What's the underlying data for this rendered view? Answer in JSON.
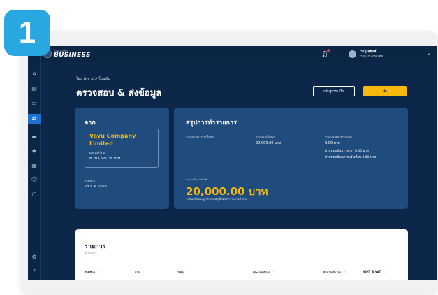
{
  "step_badge": "1",
  "brand": {
    "small": "Krungthai",
    "main": "BUSINESS"
  },
  "user": {
    "name": "วายุ อิชิงค์",
    "company": "วายุ ประเทศไทย"
  },
  "breadcrumb": "โอน & จ่าย > โอนเงิน",
  "page_title": "ตรวจสอบ & ส่งข้อมูล",
  "buttons": {
    "home": "กลับสู่การแก้ไข",
    "send": "ส่ง"
  },
  "from_card": {
    "title": "จาก",
    "account_name": "Vayu Company Limited",
    "balance_label": "ยอดเงินที่ใช้ได้",
    "balance_value": "8,203,321.36 บาท",
    "date_label": "วันที่มีผล",
    "date_value": "23 มี.ค. 2022"
  },
  "summary_card": {
    "title": "สรุปการทำรายการ",
    "count_label": "จำนวนรายการรวมทั้งหมด",
    "count_value": "1",
    "amount_label": "จำนวนเงินทั้งหมด",
    "amount_value": "20,000.00 บาท",
    "fee_label": "รายละเอียดค่าธรรมเนียม",
    "fee_value": "0.00 บาท",
    "fee_item_1": "ค่าธรรมเนียมรายการ 0.00 บาท",
    "fee_item_2": "ค่าธรรมเนียมการแจ้งเตือน 0.00 บาท",
    "total_label": "จำนวนเงินรวมทั้งสิ้น",
    "total_value": "20,000.00 บาท",
    "note": "วงเงินบริษัทจะถูกหักจากบัญชี เมื่อทำรายการสำเร็จ"
  },
  "list_panel": {
    "title": "รายการ",
    "count": "1 รายการ",
    "columns": [
      "วันที่มีผล",
      "จาก",
      "ไปยัง",
      "ประเภทบริการ",
      "จำนวนเงินโอน",
      "WHT & VAT"
    ]
  },
  "sidebar_icons": [
    "home-icon",
    "document-icon",
    "wallet-icon",
    "transfer-icon",
    "card-icon",
    "tag-icon",
    "report-icon",
    "users-icon",
    "history-icon",
    "settings-icon",
    "help-icon"
  ],
  "colors": {
    "navy": "#0c2749",
    "card": "#1f4c7d",
    "accent": "#f7b80f",
    "badge": "#29a7e1",
    "active": "#1d6fd1"
  }
}
